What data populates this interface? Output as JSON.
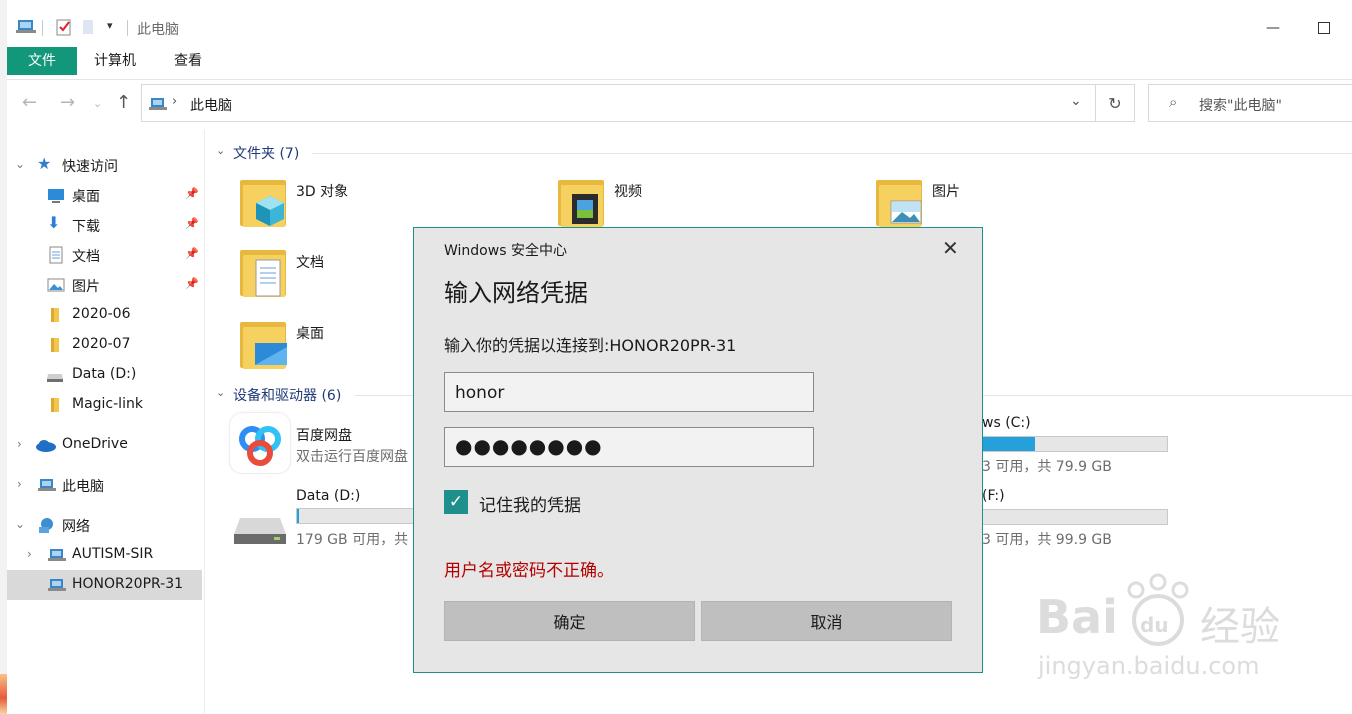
{
  "titlebar": {
    "title": "此电脑"
  },
  "ribbon": {
    "tabs": [
      "文件",
      "计算机",
      "查看"
    ]
  },
  "address": {
    "path": "此电脑",
    "search_placeholder": "搜索\"此电脑\""
  },
  "nav": {
    "items": [
      {
        "label": "快速访问",
        "icon": "star-icon"
      },
      {
        "label": "桌面",
        "icon": "desktop-icon",
        "pinned": true
      },
      {
        "label": "下载",
        "icon": "download-icon",
        "pinned": true
      },
      {
        "label": "文档",
        "icon": "document-icon",
        "pinned": true
      },
      {
        "label": "图片",
        "icon": "picture-icon",
        "pinned": true
      },
      {
        "label": "2020-06",
        "icon": "folder-icon"
      },
      {
        "label": "2020-07",
        "icon": "folder-icon"
      },
      {
        "label": "Data (D:)",
        "icon": "drive-icon"
      },
      {
        "label": "Magic-link",
        "icon": "folder-icon"
      },
      {
        "label": "OneDrive",
        "icon": "cloud-icon"
      },
      {
        "label": "此电脑",
        "icon": "computer-icon"
      },
      {
        "label": "网络",
        "icon": "network-icon"
      },
      {
        "label": "AUTISM-SIR",
        "icon": "computer-icon"
      },
      {
        "label": "HONOR20PR-31",
        "icon": "computer-icon",
        "selected": true
      }
    ]
  },
  "content": {
    "folders_header": "文件夹 (7)",
    "folders": [
      "3D 对象",
      "视频",
      "图片",
      "文档",
      "桌面"
    ],
    "devices_header": "设备和驱动器 (6)",
    "baidu": {
      "name": "百度网盘",
      "sub": "双击运行百度网盘"
    },
    "data_drive": {
      "name": "Data (D:)",
      "free": "179 GB 可用，共",
      "fill": 0.02
    },
    "c_drive": {
      "name": "ws (C:)",
      "free": "3 可用，共 79.9 GB",
      "fill": 0.28
    },
    "f_drive": {
      "name": "(F:)",
      "free": "3 可用，共 99.9 GB",
      "fill": 0.0
    }
  },
  "dialog": {
    "app_title": "Windows 安全中心",
    "heading": "输入网络凭据",
    "message": "输入你的凭据以连接到:HONOR20PR-31",
    "username": "honor",
    "password_mask": "●●●●●●●●",
    "remember_label": "记住我的凭据",
    "remember_checked": true,
    "error": "用户名或密码不正确。",
    "ok_label": "确定",
    "cancel_label": "取消"
  },
  "watermark": {
    "brand": "Bai",
    "brand2": "经验",
    "url": "jingyan.baidu.com"
  },
  "colors": {
    "accent": "#13977a",
    "dialog_border": "#1e8f8b",
    "error": "#b30000",
    "progress": "#26a0da"
  }
}
